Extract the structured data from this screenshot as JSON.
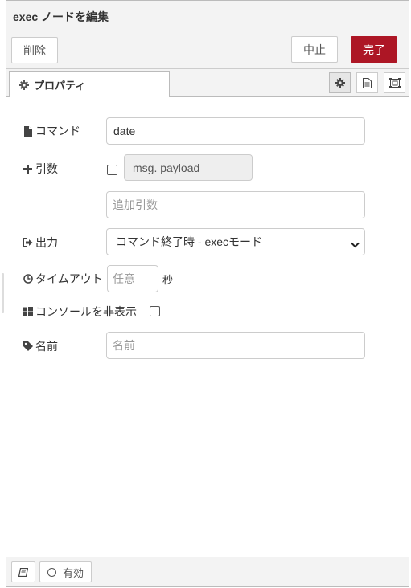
{
  "header": {
    "title": "exec ノードを編集"
  },
  "toolbar": {
    "delete_label": "削除",
    "cancel_label": "中止",
    "done_label": "完了"
  },
  "tabs": {
    "properties_label": "プロパティ"
  },
  "form": {
    "command": {
      "label": "コマンド",
      "value": "date"
    },
    "append": {
      "label": "引数",
      "payload_label": "msg. payload",
      "extra_placeholder": "追加引数"
    },
    "output": {
      "label": "出力",
      "value": "コマンド終了時 - execモード"
    },
    "timeout": {
      "label": "タイムアウト",
      "placeholder": "任意",
      "unit": "秒"
    },
    "hide_console": {
      "label": "コンソールを非表示"
    },
    "name": {
      "label": "名前",
      "placeholder": "名前"
    }
  },
  "footer": {
    "enabled_label": "有効"
  },
  "colors": {
    "accent": "#ad1625"
  },
  "icons": {
    "properties_tab": "gear-icon",
    "command": "file-icon",
    "append": "plus-icon",
    "output": "sign-out-icon",
    "timeout": "clock-icon",
    "hide_console": "windows-icon",
    "name": "tag-icon",
    "description_tab": "file-text-icon",
    "appearance_tab": "object-group-icon",
    "footer_book": "book-icon"
  }
}
